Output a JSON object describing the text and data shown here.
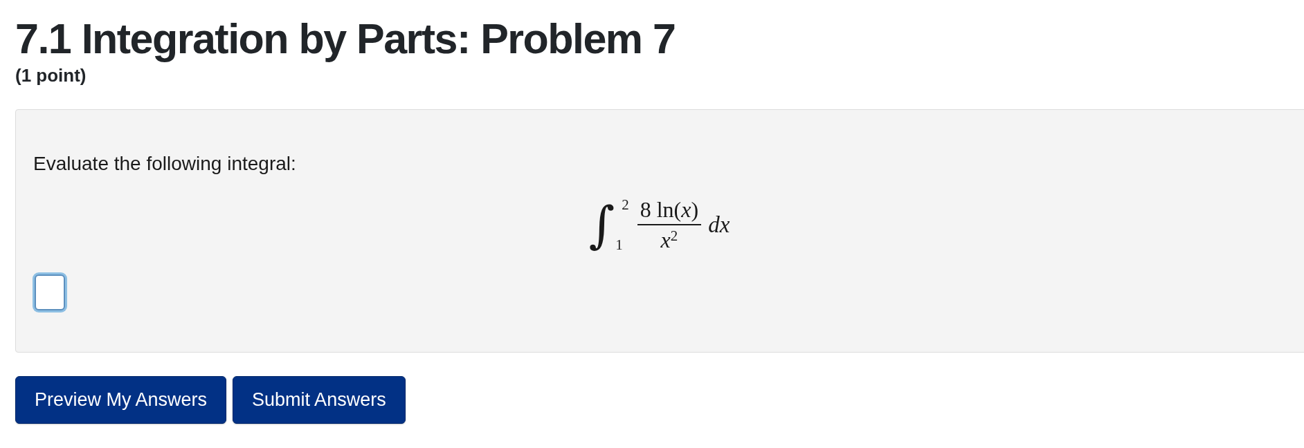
{
  "page": {
    "title": "7.1 Integration by Parts: Problem 7",
    "points": "(1 point)"
  },
  "problem": {
    "prompt": "Evaluate the following integral:",
    "integral": {
      "sign": "∫",
      "lower_limit": "1",
      "upper_limit": "2",
      "numerator": "8 ln(*x*)",
      "denominator": "*x*$^{2}$",
      "differential": "dx"
    },
    "answer_box": {
      "focused": true
    }
  },
  "buttons": [
    "Preview My Answers",
    "Submit Answers"
  ]
}
